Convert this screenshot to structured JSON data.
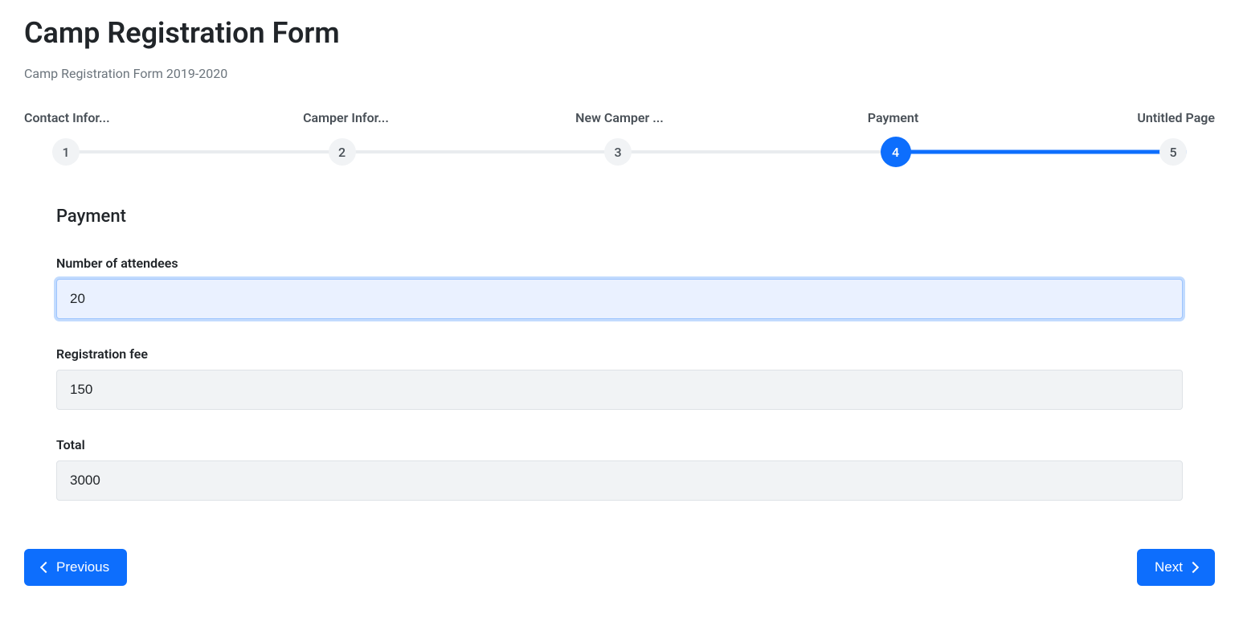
{
  "header": {
    "title": "Camp Registration Form",
    "subtitle": "Camp Registration Form 2019-2020"
  },
  "stepper": {
    "steps": [
      {
        "label": "Contact Infor...",
        "num": "1",
        "active": false
      },
      {
        "label": "Camper Infor...",
        "num": "2",
        "active": false
      },
      {
        "label": "New Camper ...",
        "num": "3",
        "active": false
      },
      {
        "label": "Payment",
        "num": "4",
        "active": true
      },
      {
        "label": "Untitled Page",
        "num": "5",
        "active": false
      }
    ],
    "active_index": 3,
    "progress_start_pct": 75,
    "progress_end_pct": 100
  },
  "section": {
    "title": "Payment",
    "fields": {
      "attendees": {
        "label": "Number of attendees",
        "value": "20",
        "editable": true,
        "focused": true
      },
      "fee": {
        "label": "Registration fee",
        "value": "150",
        "editable": false
      },
      "total": {
        "label": "Total",
        "value": "3000",
        "editable": false
      }
    }
  },
  "nav": {
    "prev_label": "Previous",
    "next_label": "Next"
  }
}
